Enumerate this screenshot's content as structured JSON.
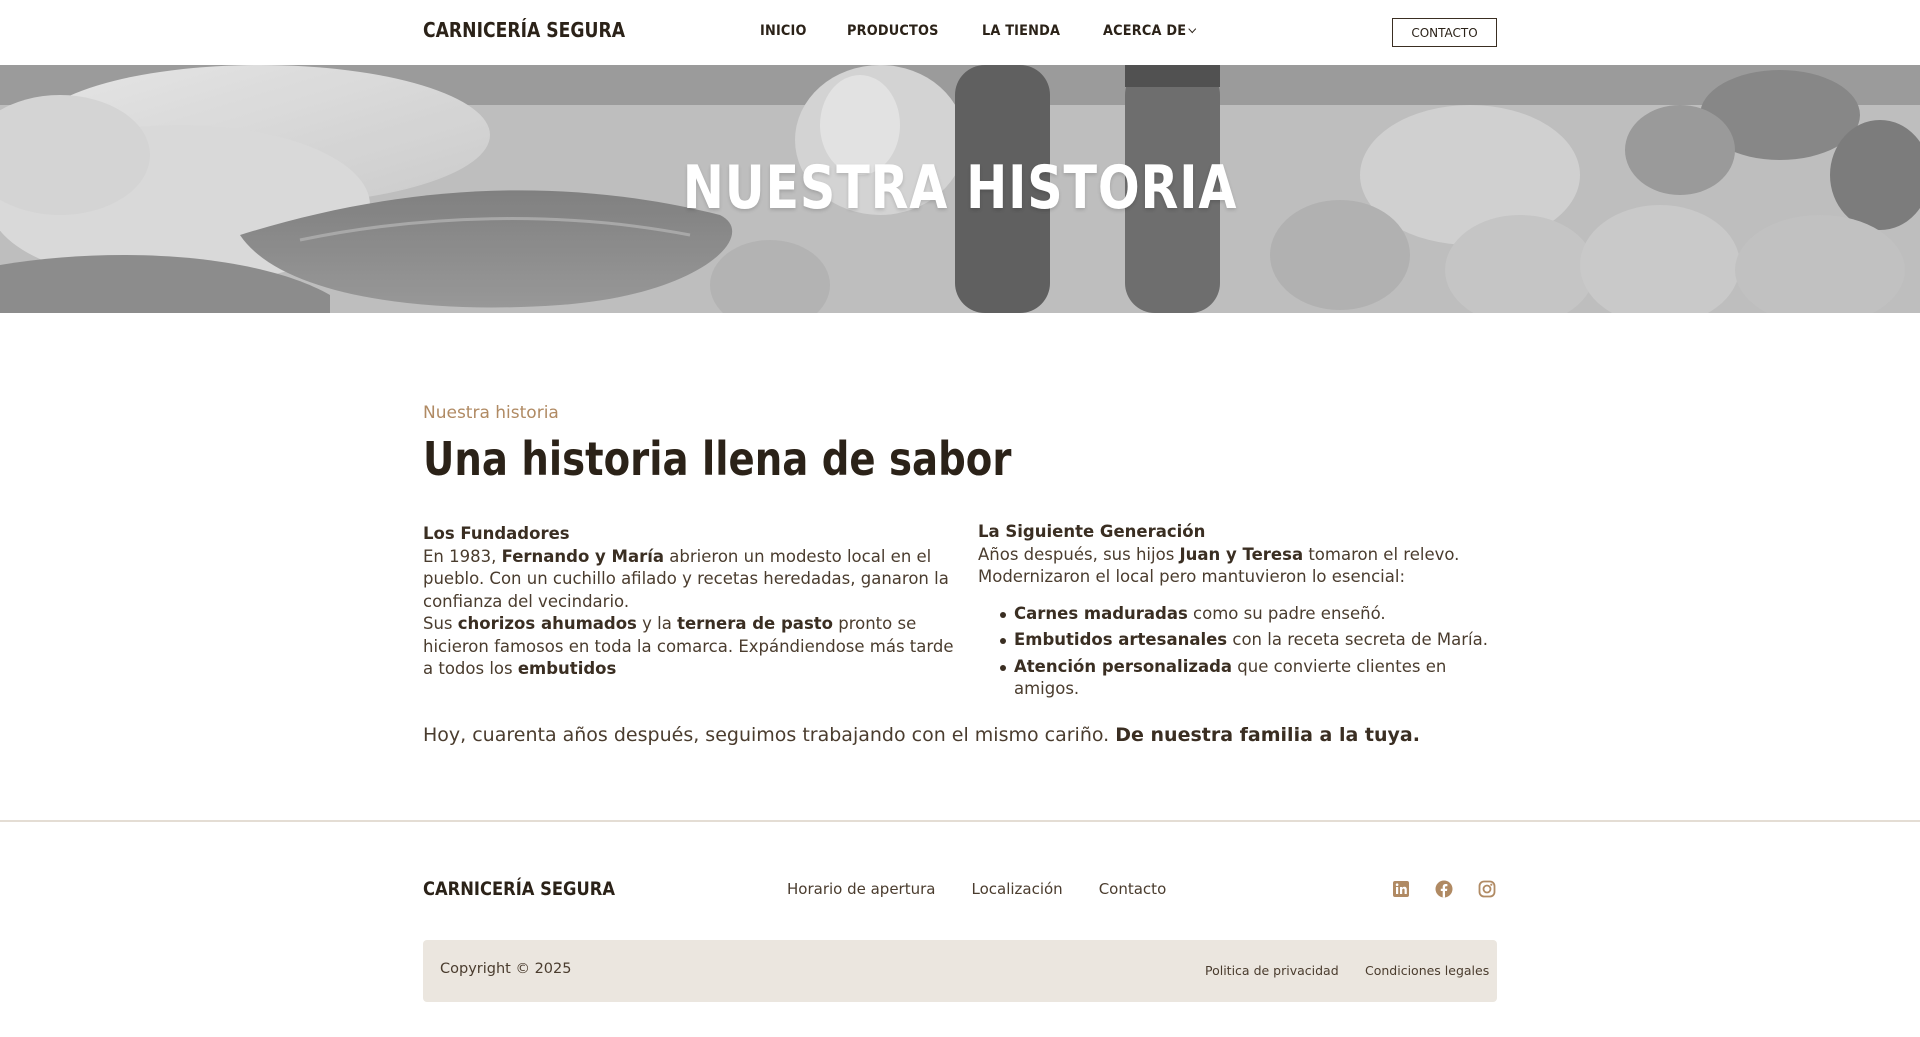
{
  "header": {
    "logo": "CARNICERÍA SEGURA",
    "nav": [
      "INICIO",
      "PRODUCTOS",
      "LA TIENDA",
      "ACERCA DE"
    ],
    "contact_button": "CONTACTO"
  },
  "hero": {
    "title": "NUESTRA HISTORIA",
    "image_description": "grayscale photo of meats, garlic, salt and pepper grinders, peppers and lettuce"
  },
  "story": {
    "eyebrow": "Nuestra historia",
    "title": "Una historia llena de sabor",
    "founders": {
      "heading": "Los Fundadores",
      "p1_a": "En 1983, ",
      "p1_b": "Fernando y María",
      "p1_c": " abrieron un modesto local en el pueblo. Con un cuchillo afilado y recetas heredadas, ganaron la confianza del vecindario.",
      "p2_a": "Sus ",
      "p2_b": "chorizos ahumados",
      "p2_c": " y la ",
      "p2_d": "ternera de pasto",
      "p2_e": " pronto se hicieron famosos en toda la comarca. Expándiendose más tarde a todos los ",
      "p2_f": "embutidos"
    },
    "next_generation": {
      "heading": "La Siguiente Generación",
      "p1_a": "Años después, sus hijos ",
      "p1_b": "Juan y Teresa",
      "p1_c": " tomaron el relevo. Modernizaron el local pero mantuvieron lo esencial:",
      "items": [
        {
          "bold": "Carnes maduradas",
          "rest": " como su padre enseñó."
        },
        {
          "bold": "Embutidos artesanales",
          "rest": " con la receta secreta de María."
        },
        {
          "bold": "Atención personalizada",
          "rest": " que convierte clientes en amigos."
        }
      ]
    },
    "closing_a": "Hoy, cuarenta años después, seguimos trabajando con el mismo cariño. ",
    "closing_b": "De nuestra familia a la tuya."
  },
  "footer": {
    "logo": "CARNICERÍA SEGURA",
    "links": [
      "Horario de apertura",
      "Localización",
      "Contacto"
    ],
    "social_icons": [
      "linkedin-icon",
      "facebook-icon",
      "instagram-icon"
    ],
    "icon_color": "#b08a63",
    "copyright": "Copyright © 2025",
    "legal_links": [
      "Politica de privacidad",
      "Condiciones legales"
    ]
  }
}
